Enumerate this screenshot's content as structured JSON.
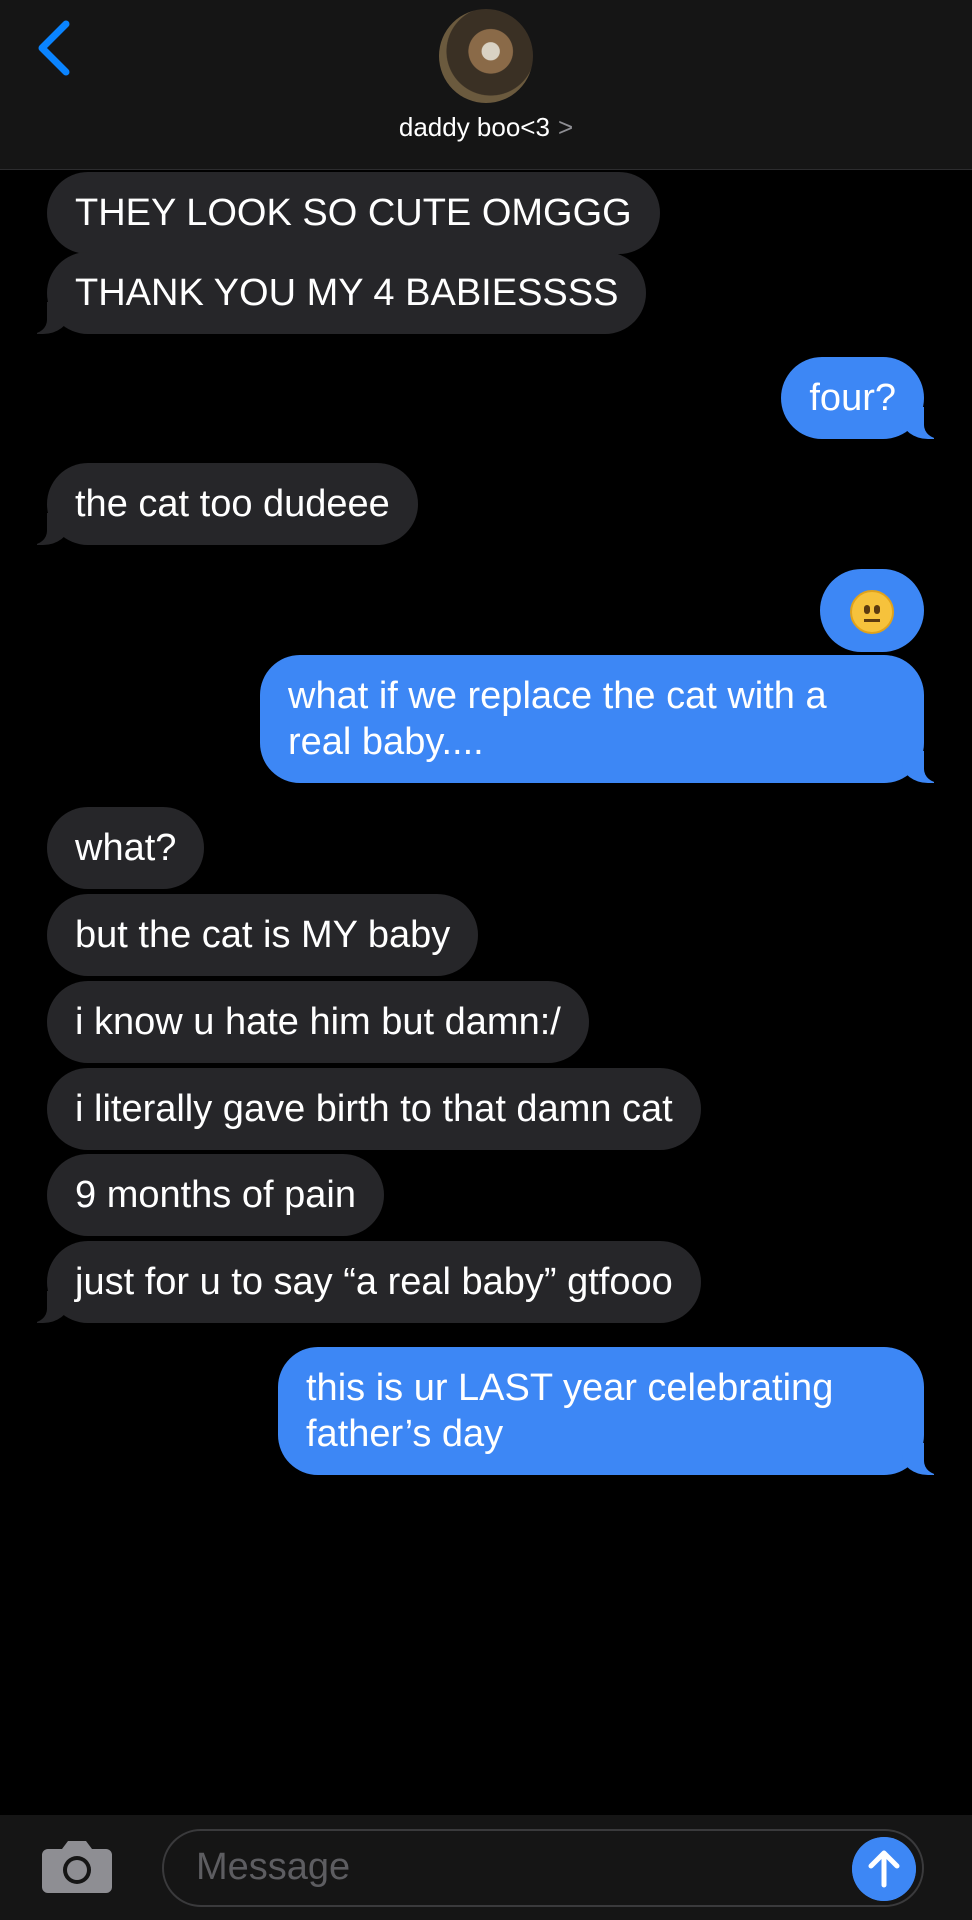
{
  "header": {
    "contact_name": "daddy boo<3",
    "chevron": ">"
  },
  "messages": [
    {
      "direction": "incoming",
      "text": "THEY LOOK SO CUTE OMGGG"
    },
    {
      "direction": "incoming",
      "text": "THANK YOU MY 4 BABIESSSS"
    },
    {
      "direction": "outgoing",
      "text": "four?"
    },
    {
      "direction": "incoming",
      "text": "the cat too dudeee"
    },
    {
      "direction": "outgoing",
      "text": "",
      "emoji": "neutral-face-emoji"
    },
    {
      "direction": "outgoing",
      "text": "what if we replace the cat with a real baby...."
    },
    {
      "direction": "incoming",
      "text": "what?"
    },
    {
      "direction": "incoming",
      "text": "but the cat is MY baby"
    },
    {
      "direction": "incoming",
      "text": "i know u hate him but damn:/"
    },
    {
      "direction": "incoming",
      "text": "i literally gave birth to that damn cat"
    },
    {
      "direction": "incoming",
      "text": "9 months of pain"
    },
    {
      "direction": "incoming",
      "text": "just for u to say “a real baby” gtfooo"
    },
    {
      "direction": "outgoing",
      "text": "this is ur LAST year celebrating father’s day"
    }
  ],
  "composer": {
    "placeholder": "Message"
  },
  "colors": {
    "incoming_bubble": "#262629",
    "outgoing_bubble": "#3d87f5",
    "accent": "#0a84ff",
    "background": "#000000"
  },
  "icons": [
    "back-chevron-icon",
    "camera-icon",
    "send-arrow-icon",
    "contact-chevron-icon"
  ]
}
